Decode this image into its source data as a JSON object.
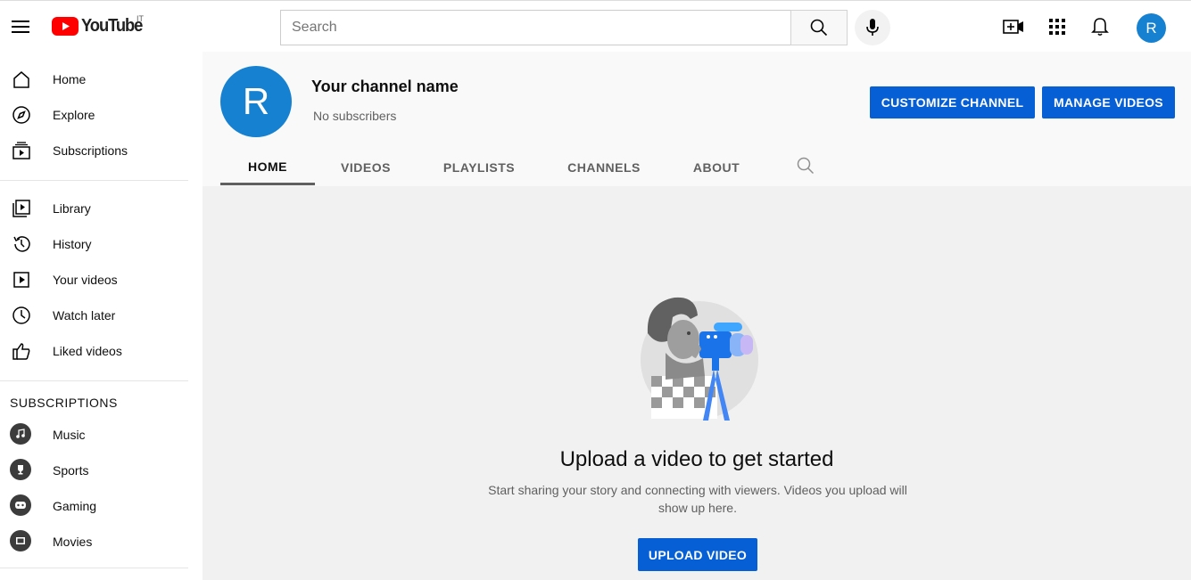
{
  "header": {
    "logo_text": "YouTube",
    "country_code": "IT",
    "search_placeholder": "Search",
    "avatar_letter": "R",
    "icons": [
      "menu-icon",
      "search-icon",
      "mic-icon",
      "create-video-icon",
      "apps-icon",
      "bell-icon"
    ]
  },
  "sidebar": {
    "primary": [
      {
        "label": "Home",
        "icon": "home-icon"
      },
      {
        "label": "Explore",
        "icon": "compass-icon"
      },
      {
        "label": "Subscriptions",
        "icon": "subscriptions-icon"
      }
    ],
    "library": [
      {
        "label": "Library",
        "icon": "library-icon"
      },
      {
        "label": "History",
        "icon": "history-icon"
      },
      {
        "label": "Your videos",
        "icon": "play-icon"
      },
      {
        "label": "Watch later",
        "icon": "clock-icon"
      },
      {
        "label": "Liked videos",
        "icon": "thumbs-up-icon"
      }
    ],
    "subscriptions_title": "SUBSCRIPTIONS",
    "subscriptions": [
      {
        "label": "Music",
        "icon": "music-note-icon"
      },
      {
        "label": "Sports",
        "icon": "trophy-icon"
      },
      {
        "label": "Gaming",
        "icon": "gamepad-icon"
      },
      {
        "label": "Movies",
        "icon": "film-icon"
      }
    ]
  },
  "channel": {
    "avatar_letter": "R",
    "name": "Your channel name",
    "subscribers": "No subscribers",
    "customize_label": "CUSTOMIZE CHANNEL",
    "manage_label": "MANAGE VIDEOS",
    "tabs": [
      "HOME",
      "VIDEOS",
      "PLAYLISTS",
      "CHANNELS",
      "ABOUT"
    ],
    "active_tab": "HOME"
  },
  "empty_state": {
    "title": "Upload a video to get started",
    "description": "Start sharing your story and connecting with viewers. Videos you upload will show up here.",
    "button_label": "UPLOAD VIDEO"
  },
  "colors": {
    "accent_blue": "#065fd4",
    "avatar_blue": "#1581d0",
    "logo_red": "#ff0000"
  }
}
